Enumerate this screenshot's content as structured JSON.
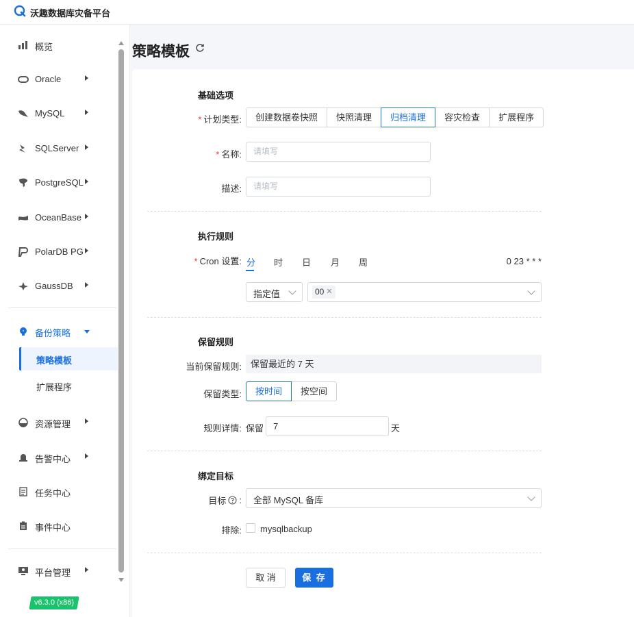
{
  "app": {
    "title": "沃趣数据库灾备平台",
    "logo_icon": "q-logo-icon",
    "brand_color": "#1a6fe0"
  },
  "sidebar": {
    "items": [
      {
        "label": "概览",
        "icon": "bar-chart-icon",
        "has_arrow": false
      },
      {
        "label": "Oracle",
        "icon": "oracle-icon",
        "has_arrow": true
      },
      {
        "label": "MySQL",
        "icon": "mysql-icon",
        "has_arrow": true
      },
      {
        "label": "SQLServer",
        "icon": "sqlserver-icon",
        "has_arrow": true
      },
      {
        "label": "PostgreSQL",
        "icon": "postgresql-icon",
        "has_arrow": true
      },
      {
        "label": "OceanBase",
        "icon": "oceanbase-icon",
        "has_arrow": true
      },
      {
        "label": "PolarDB PG",
        "icon": "polardb-icon",
        "has_arrow": true
      },
      {
        "label": "GaussDB",
        "icon": "gaussdb-icon",
        "has_arrow": true
      },
      {
        "label": "备份策略",
        "icon": "lightbulb-icon",
        "has_arrow": true,
        "expanded": true
      },
      {
        "label": "资源管理",
        "icon": "resource-icon",
        "has_arrow": true
      },
      {
        "label": "告警中心",
        "icon": "alarm-icon",
        "has_arrow": true
      },
      {
        "label": "任务中心",
        "icon": "task-icon",
        "has_arrow": false
      },
      {
        "label": "事件中心",
        "icon": "event-icon",
        "has_arrow": false
      },
      {
        "label": "平台管理",
        "icon": "monitor-icon",
        "has_arrow": true
      }
    ],
    "sub_items": [
      {
        "label": "策略模板",
        "active": true
      },
      {
        "label": "扩展程序",
        "active": false
      }
    ],
    "version": "v6.3.0 (x86)"
  },
  "page": {
    "title": "策略模板",
    "refresh_icon": "refresh-icon"
  },
  "form": {
    "basic": {
      "section_title": "基础选项",
      "plan_type_label": "计划类型:",
      "plan_types": [
        "创建数据卷快照",
        "快照清理",
        "归档清理",
        "容灾检查",
        "扩展程序"
      ],
      "plan_type_selected": "归档清理",
      "name_label": "名称:",
      "name_placeholder": "请填写",
      "desc_label": "描述:",
      "desc_placeholder": "请填写"
    },
    "exec": {
      "section_title": "执行规则",
      "cron_label": "Cron 设置:",
      "cron_tabs": [
        "分",
        "时",
        "日",
        "月",
        "周"
      ],
      "cron_tab_selected": "分",
      "cron_expression": "0 23 * * *",
      "mode_value": "指定值",
      "minute_tag": "00"
    },
    "retention": {
      "section_title": "保留规则",
      "current_label": "当前保留规则:",
      "current_value": "保留最近的 7 天",
      "type_label": "保留类型:",
      "type_options": [
        "按时间",
        "按空间"
      ],
      "type_selected": "按时间",
      "detail_label": "规则详情:",
      "detail_prefix": "保留",
      "detail_value": "7",
      "detail_suffix": "天"
    },
    "binding": {
      "section_title": "绑定目标",
      "target_label": "目标",
      "target_help_icon": "question-circle-icon",
      "target_colon": ":",
      "target_value": "全部 MySQL 备库",
      "exclude_label": "排除:",
      "exclude_option": "mysqlbackup",
      "exclude_checked": false
    },
    "actions": {
      "cancel": "取 消",
      "save": "保 存"
    }
  }
}
